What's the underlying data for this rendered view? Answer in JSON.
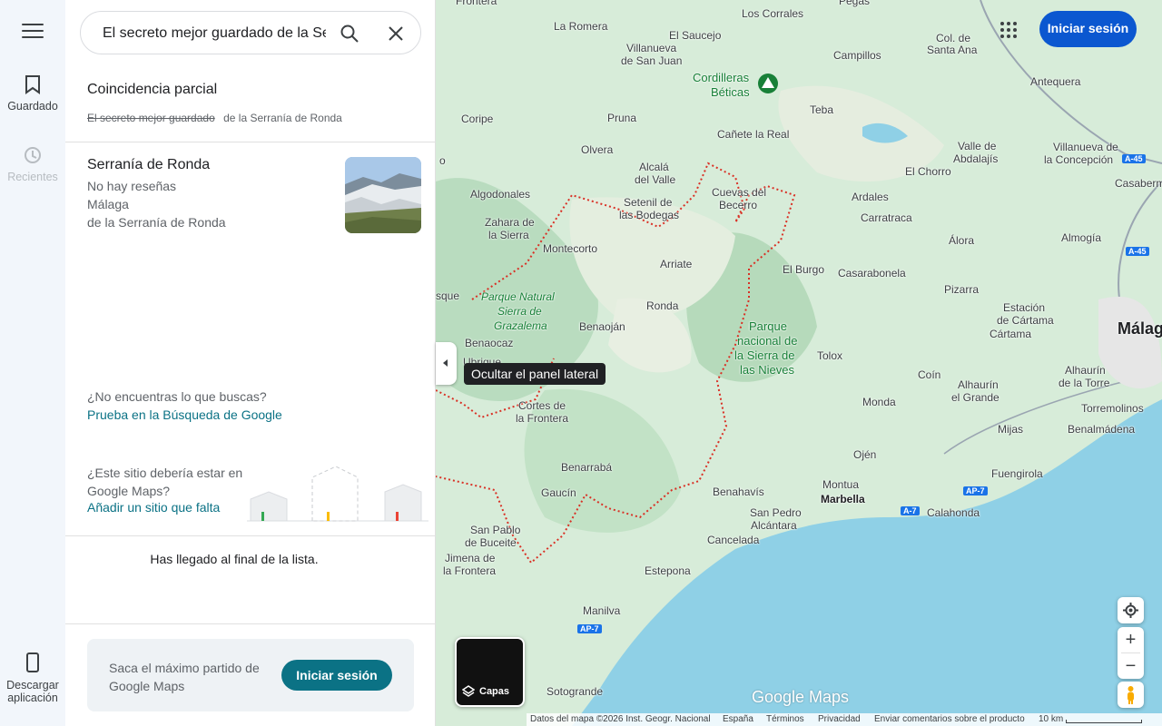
{
  "rail": {
    "saved_label": "Guardado",
    "recents_label": "Recientes",
    "download_label_1": "Descargar",
    "download_label_2": "aplicación"
  },
  "search": {
    "value": "El secreto mejor guardado de la Serranía de Ronda"
  },
  "partial_match": {
    "title": "Coincidencia parcial",
    "struck_text": "El secreto mejor guardado",
    "matched_text": "de la Serranía de Ronda"
  },
  "result": {
    "name": "Serranía de Ronda",
    "reviews": "No hay reseñas",
    "province": "Málaga",
    "descriptor": "de la Serranía de Ronda"
  },
  "help": {
    "question": "¿No encuentras lo que buscas?",
    "link": "Prueba en la Búsqueda de Google",
    "add_question": "¿Este sitio debería estar en Google Maps?",
    "add_link": "Añadir un sitio que falta"
  },
  "end_message": "Has llegado al final de la lista.",
  "promo": {
    "text": "Saca el máximo partido de Google Maps",
    "button": "Iniciar sesión"
  },
  "tooltip": "Ocultar el panel lateral",
  "top_signin": "Iniciar sesión",
  "layers_label": "Capas",
  "map_logo": "Google Maps",
  "footer": {
    "data": "Datos del mapa ©2026 Inst. Geogr. Nacional",
    "country": "España",
    "terms": "Términos",
    "privacy": "Privacidad",
    "feedback": "Enviar comentarios sobre el producto",
    "scale": "10 km"
  },
  "map_labels": {
    "frontera": "Frontera",
    "pegas": "Pegas",
    "los_corrales": "Los Corrales",
    "la_romera": "La Romera",
    "el_saucejo": "El Saucejo",
    "villanueva_1": "Villanueva",
    "villanueva_2": "de San Juan",
    "col_de": "Col. de",
    "santa_ana": "Santa Ana",
    "campillos": "Campillos",
    "antequera": "Antequera",
    "cordilleras": "Cordilleras",
    "beticas": "Béticas",
    "coripe": "Coripe",
    "pruna": "Pruna",
    "teba": "Teba",
    "canete": "Cañete la Real",
    "olvera": "Olvera",
    "valle_1": "Valle de",
    "valle_2": "Abdalajís",
    "villanueva_c_1": "Villanueva de",
    "villanueva_c_2": "la Concepción",
    "alcala_1": "Alcalá",
    "alcala_2": "del Valle",
    "el_chorro": "El Chorro",
    "casaberm": "Casaberm",
    "algodonales": "Algodonales",
    "setenil_1": "Setenil de",
    "setenil_2": "las Bodegas",
    "cuevas_1": "Cuevas del",
    "cuevas_2": "Becerro",
    "ardales": "Ardales",
    "zahara_1": "Zahara de",
    "zahara_2": "la Sierra",
    "carratraca": "Carratraca",
    "almogia": "Almogía",
    "alora": "Álora",
    "montecorto": "Montecorto",
    "arriate": "Arriate",
    "el_burgo": "El Burgo",
    "casarabonela": "Casarabonela",
    "pizarra": "Pizarra",
    "sque": "sque",
    "pn_grazalema_1": "Parque Natural",
    "pn_grazalema_2": "Sierra de",
    "pn_grazalema_3": "Grazalema",
    "ronda": "Ronda",
    "estacion_1": "Estación",
    "estacion_2": "de Cártama",
    "cartama": "Cártama",
    "malaga": "Málag",
    "parque_1": "Parque",
    "parque_2": "nacional de",
    "parque_3": "la Sierra de",
    "parque_4": "las Nieves",
    "benaojan": "Benaoján",
    "benaocaz": "Benaocaz",
    "tolox": "Tolox",
    "ubrique": "Ubrique",
    "coin": "Coín",
    "alhaurin_r_1": "Alhaurín",
    "alhaurin_r_2": "de la Torre",
    "alhaurin_g_1": "Alhaurín",
    "alhaurin_g_2": "el Grande",
    "monda": "Monda",
    "torremolinos": "Torremolinos",
    "cortes_1": "Cortes de",
    "cortes_2": "la Frontera",
    "mijas": "Mijas",
    "benalmadena": "Benalmádena",
    "ojen": "Ojén",
    "benarraba": "Benarrabá",
    "fuengirola": "Fuengirola",
    "gaucin": "Gaucín",
    "montua": "Montua",
    "marbella": "Marbella",
    "benahavis": "Benahavís",
    "calahonda": "Calahonda",
    "san_pedro_1": "San Pedro",
    "san_pedro_2": "Alcántara",
    "san_pablo_1": "San Pablo",
    "san_pablo_2": "de Buceite",
    "cancelada": "Cancelada",
    "jimena_1": "Jimena de",
    "jimena_2": "la Frontera",
    "estepona": "Estepona",
    "manilva": "Manilva",
    "sotogrande": "Sotogrande",
    "ao": "o",
    "a45_a": "A-45",
    "a45_b": "A-45",
    "ap7_a": "AP-7",
    "ap7_b": "AP-7",
    "a7": "A-7"
  },
  "colors": {
    "accent_teal": "#0b7285",
    "signin_blue": "#0b57d0",
    "sea": "#8fd0e6",
    "land": "#cfe8d6",
    "boundary": "#d93025"
  }
}
